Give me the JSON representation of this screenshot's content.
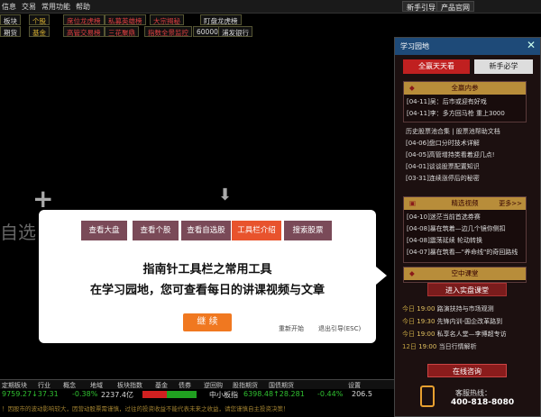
{
  "menubar": {
    "items": [
      "信息",
      "交易",
      "常用功能",
      "帮助"
    ],
    "right_buttons": [
      "新手引导",
      "产品官网"
    ]
  },
  "toolbar": {
    "row1": [
      "板块",
      "个股",
      "席位龙虎榜",
      "私募英雄榜",
      "大宗揭秘",
      "盯盘龙虎榜"
    ],
    "row2": [
      "期货",
      "基金",
      "高管交易榜",
      "三花聚鼎",
      "指数全景监控",
      "600000",
      "浦发银行"
    ]
  },
  "background": {
    "watchlist_label": "自选"
  },
  "guide": {
    "tabs": [
      "查看大盘",
      "查看个股",
      "查看自选股",
      "工具栏介绍",
      "搜索股票"
    ],
    "active_tab": 3,
    "title": "指南针工具栏之常用工具",
    "subtitle": "在学习园地，您可查看每日的讲课视频与文章",
    "continue_label": "继 续",
    "restart_label": "重新开始",
    "exit_label": "退出引导(ESC)"
  },
  "panel": {
    "title": "学习园地",
    "tab_primary": "全赢天天看",
    "tab_secondary": "新手必学",
    "section1": {
      "title": "全赢内参",
      "items": [
        "[04-11]吴：后市或迎有好戏",
        "[04-11]李：多方回马枪 重上3000"
      ]
    },
    "section1_list": [
      "历史股票池合集 | 股票池帮助文档",
      "[04-06]盘口分时技术详解",
      "[04-05]高管增持类看着迎几点!",
      "[04-01]谈谈股票配置知识",
      "[03-31]连续涨停后的秘密"
    ],
    "section2": {
      "title": "精选视频",
      "more": "更多>>",
      "items": [
        "[04-10]迷茫当前首选券赛",
        "[04-08]暴在筑着—边几个镜你侧扣",
        "[04-08]震荡延续 轮动转换",
        "[04-07]暴在筑看—\"养命线\"的奇回路线"
      ]
    },
    "section3": {
      "title": "空中课堂",
      "enter_button": "进入实盘课堂",
      "schedule": [
        {
          "day": "今日",
          "time": "19:00",
          "name": "路演扶持与市场观测"
        },
        {
          "day": "今日",
          "time": "19:30",
          "name": "先锋内训-国企改革路到"
        },
        {
          "day": "今日",
          "time": "19:00",
          "name": "私享名人堂—李博超专访"
        },
        {
          "day": "12日",
          "time": "19:00",
          "name": "当日行情解析"
        }
      ]
    },
    "consult_button": "在线咨询",
    "hotline_label": "客服热线：",
    "hotline_number": "400-818-8080"
  },
  "bottom_tabs": [
    "定期板块",
    "行业",
    "概念",
    "地域",
    "板块指数",
    "基金",
    "债券",
    "逆回购",
    "股指期货",
    "国债期货",
    "设置"
  ],
  "ticker": {
    "left_value": "9759.27↓37.31",
    "left_pct": "-0.38%",
    "left_amount": "2237.4亿",
    "mid_label": "中小板指",
    "mid_value": "6398.48↑28.281",
    "mid_pct": "-0.44%",
    "mid_amount": "206.5"
  },
  "statusbar": {
    "text": "！因股市的波动影响较大，因营动股票需谨慎，过往的投资收益不能代表未来之收益，请您谨慎自主投资决策！"
  }
}
